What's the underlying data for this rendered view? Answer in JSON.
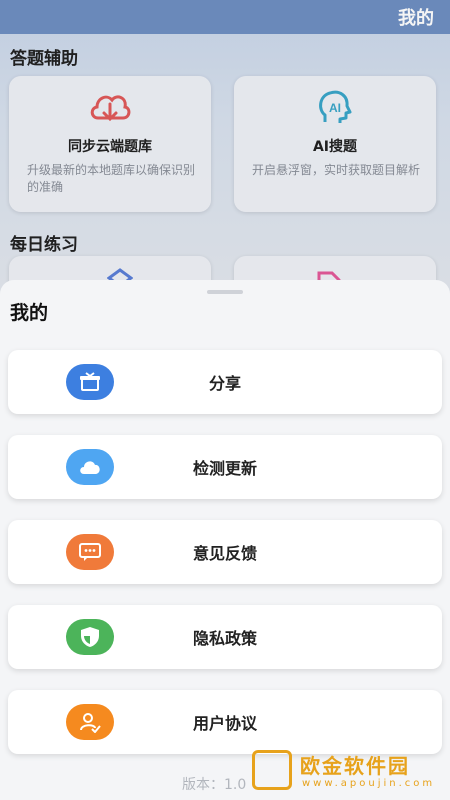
{
  "header": {
    "title": "我的"
  },
  "sections": {
    "assist_title": "答题辅助",
    "daily_title": "每日练习"
  },
  "cards": [
    {
      "title": "同步云端题库",
      "desc": "升级最新的本地题库以确保识别的准确"
    },
    {
      "title": "AI搜题",
      "desc": "开启悬浮窗，实时获取题目解析"
    }
  ],
  "sheet": {
    "title": "我的",
    "items": [
      {
        "label": "分享",
        "icon": "gift-icon",
        "color": "#3d7fe0"
      },
      {
        "label": "检测更新",
        "icon": "cloud-icon",
        "color": "#4fa6f2"
      },
      {
        "label": "意见反馈",
        "icon": "message-icon",
        "color": "#f07a3a"
      },
      {
        "label": "隐私政策",
        "icon": "shield-icon",
        "color": "#4cb45a"
      },
      {
        "label": "用户协议",
        "icon": "user-check-icon",
        "color": "#f58a1f"
      }
    ],
    "version": "版本：1.0"
  },
  "watermark": {
    "text": "欧金软件园",
    "url": "www.apoujin.com"
  }
}
